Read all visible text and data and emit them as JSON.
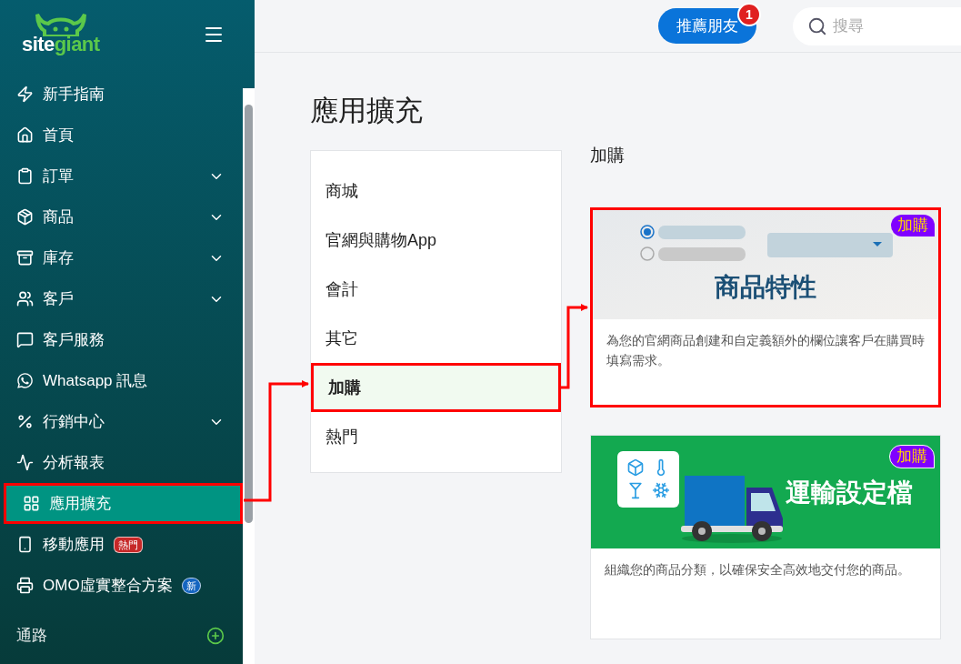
{
  "sidebar": {
    "logo": {
      "part_1": "site",
      "part_2": "giant"
    },
    "items": [
      {
        "label": "新手指南",
        "expandable": false,
        "selected": false,
        "highlighted": false
      },
      {
        "label": "首頁",
        "expandable": false,
        "selected": false,
        "highlighted": false
      },
      {
        "label": "訂單",
        "expandable": true,
        "selected": false,
        "highlighted": false
      },
      {
        "label": "商品",
        "expandable": true,
        "selected": false,
        "highlighted": false
      },
      {
        "label": "庫存",
        "expandable": true,
        "selected": false,
        "highlighted": false
      },
      {
        "label": "客戶",
        "expandable": true,
        "selected": false,
        "highlighted": false
      },
      {
        "label": "客戶服務",
        "expandable": false,
        "selected": false,
        "highlighted": false
      },
      {
        "label": "Whatsapp 訊息",
        "expandable": false,
        "selected": false,
        "highlighted": false
      },
      {
        "label": "行銷中心",
        "expandable": true,
        "selected": false,
        "highlighted": false
      },
      {
        "label": "分析報表",
        "expandable": false,
        "selected": false,
        "highlighted": false
      },
      {
        "label": "應用擴充",
        "expandable": false,
        "selected": true,
        "highlighted": true
      },
      {
        "label": "移動應用",
        "expandable": false,
        "selected": false,
        "highlighted": false,
        "badge": {
          "text": "熱門",
          "kind": "hot"
        }
      },
      {
        "label": "OMO虛實整合方案",
        "expandable": false,
        "selected": false,
        "highlighted": false,
        "badge": {
          "text": "新",
          "kind": "new"
        }
      }
    ],
    "section": {
      "label": "通路"
    }
  },
  "header": {
    "refer_button": "推薦朋友",
    "notification_count": "1",
    "search": {
      "placeholder": "搜尋"
    }
  },
  "page": {
    "title": "應用擴充",
    "categories": [
      {
        "label": "商城",
        "selected": false,
        "highlighted": false
      },
      {
        "label": "官網與購物App",
        "selected": false,
        "highlighted": false
      },
      {
        "label": "會計",
        "selected": false,
        "highlighted": false
      },
      {
        "label": "其它",
        "selected": false,
        "highlighted": false
      },
      {
        "label": "加購",
        "selected": true,
        "highlighted": true
      },
      {
        "label": "熱門",
        "selected": false,
        "highlighted": false
      }
    ],
    "section_title": "加購",
    "cards": [
      {
        "kind": "attributes",
        "banner_title": "商品特性",
        "badge": "加購",
        "description": "為您的官網商品創建和自定義額外的欄位讓客戶在購買時填寫需求。",
        "highlighted": true
      },
      {
        "kind": "shipping",
        "banner_title": "運輸設定檔",
        "badge": "加購",
        "description": "組織您的商品分類，以確保安全高效地交付您的商品。",
        "highlighted": false
      }
    ]
  }
}
